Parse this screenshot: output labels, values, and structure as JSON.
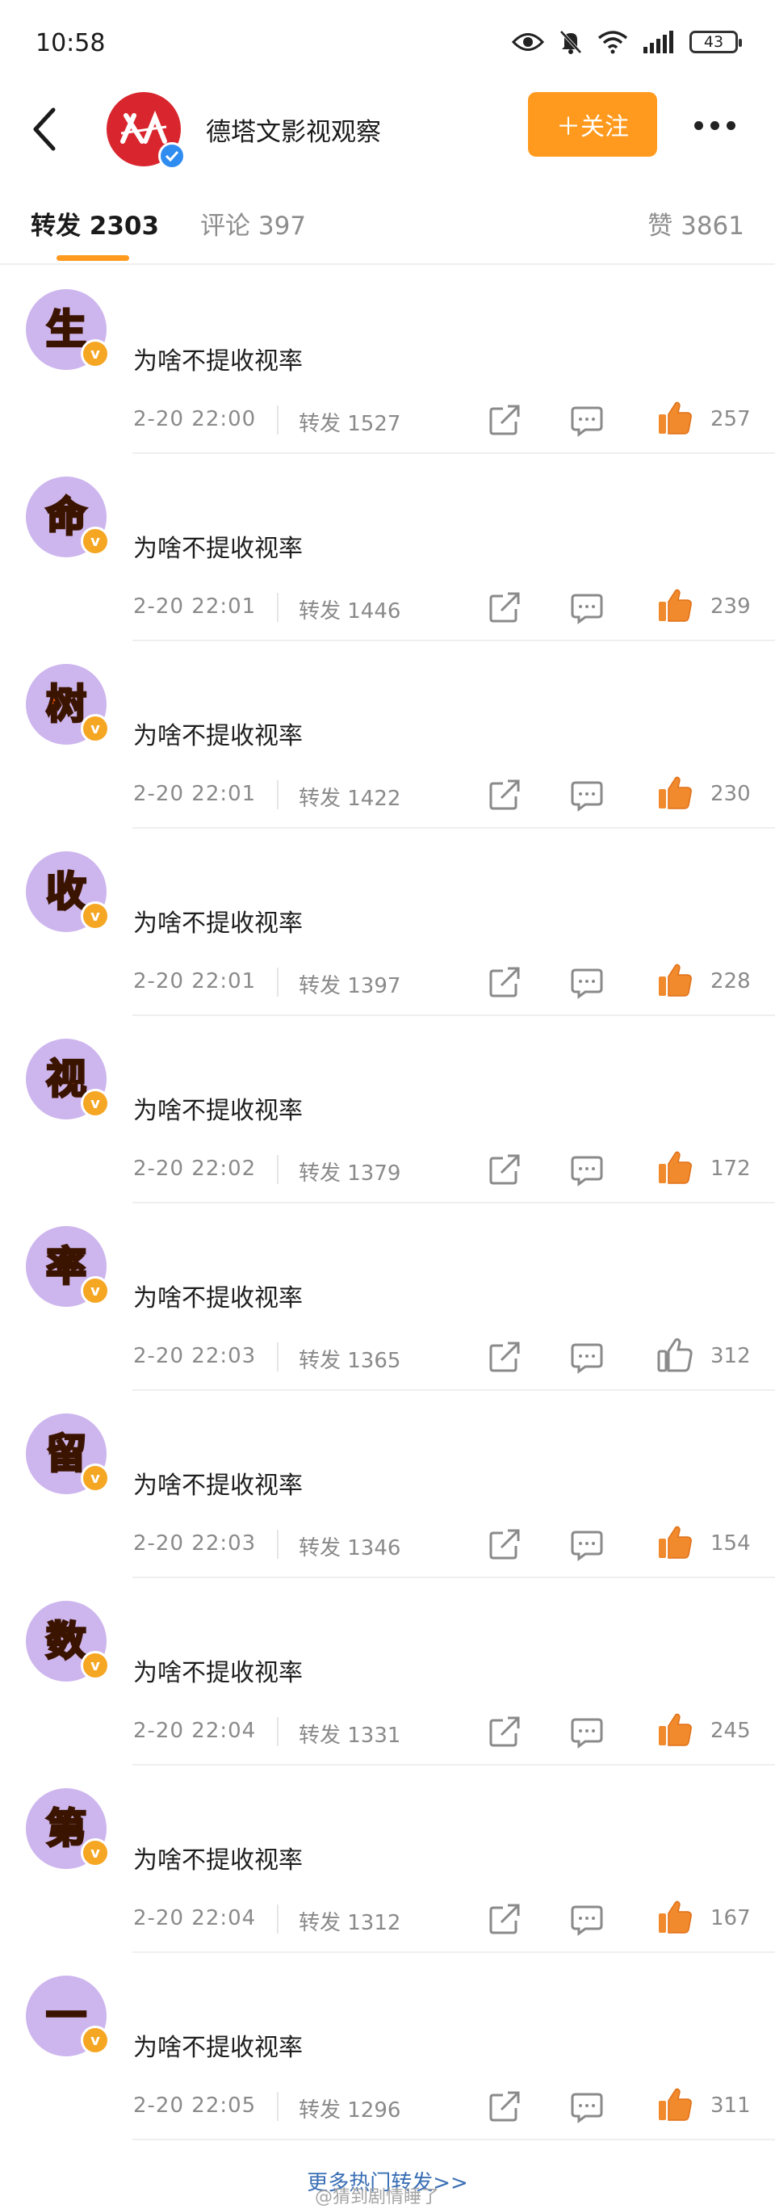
{
  "status_bar": {
    "time": "10:58",
    "battery": "43",
    "icons": [
      "eye-icon",
      "mute-bell-icon",
      "wifi-icon",
      "signal-icon",
      "battery-icon"
    ]
  },
  "header": {
    "account_name": "德塔文影视观察",
    "follow_label": "＋关注",
    "follow_color": "#ff9a1e"
  },
  "tabs": {
    "repost": "转发 2303",
    "comment": "评论 397",
    "like": "赞 3861"
  },
  "reposts": [
    {
      "char": "生",
      "text": "为啥不提收视率",
      "time": "2-20 22:00",
      "repost": "转发 1527",
      "likes": "257",
      "liked": true
    },
    {
      "char": "命",
      "text": "为啥不提收视率",
      "time": "2-20 22:01",
      "repost": "转发 1446",
      "likes": "239",
      "liked": true
    },
    {
      "char": "树",
      "text": "为啥不提收视率",
      "time": "2-20 22:01",
      "repost": "转发 1422",
      "likes": "230",
      "liked": true
    },
    {
      "char": "收",
      "text": "为啥不提收视率",
      "time": "2-20 22:01",
      "repost": "转发 1397",
      "likes": "228",
      "liked": true
    },
    {
      "char": "视",
      "text": "为啥不提收视率",
      "time": "2-20 22:02",
      "repost": "转发 1379",
      "likes": "172",
      "liked": true
    },
    {
      "char": "率",
      "text": "为啥不提收视率",
      "time": "2-20 22:03",
      "repost": "转发 1365",
      "likes": "312",
      "liked": false
    },
    {
      "char": "留",
      "text": "为啥不提收视率",
      "time": "2-20 22:03",
      "repost": "转发 1346",
      "likes": "154",
      "liked": true
    },
    {
      "char": "数",
      "text": "为啥不提收视率",
      "time": "2-20 22:04",
      "repost": "转发 1331",
      "likes": "245",
      "liked": true
    },
    {
      "char": "第",
      "text": "为啥不提收视率",
      "time": "2-20 22:04",
      "repost": "转发 1312",
      "likes": "167",
      "liked": true
    },
    {
      "char": "一",
      "text": "为啥不提收视率",
      "time": "2-20 22:05",
      "repost": "转发 1296",
      "likes": "311",
      "liked": true
    }
  ],
  "footer": {
    "more_link": "更多热门转发>>",
    "watermark": "@猜到剧情睡了"
  },
  "colors": {
    "accent": "#ff9a1e",
    "avatar_bg": "#cdb5ee",
    "like_active": "#f08a2c"
  }
}
